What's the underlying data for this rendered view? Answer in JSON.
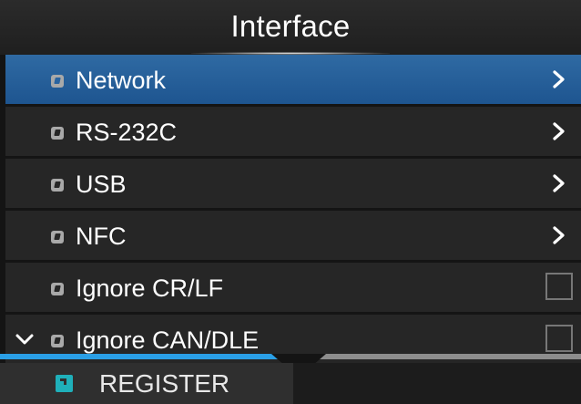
{
  "header": {
    "title": "Interface"
  },
  "menu": {
    "items": [
      {
        "label": "Network",
        "control": "chevron",
        "selected": true
      },
      {
        "label": "RS-232C",
        "control": "chevron",
        "selected": false
      },
      {
        "label": "USB",
        "control": "chevron",
        "selected": false
      },
      {
        "label": "NFC",
        "control": "chevron",
        "selected": false
      },
      {
        "label": "Ignore CR/LF",
        "control": "checkbox",
        "checked": false,
        "selected": false
      },
      {
        "label": "Ignore CAN/DLE",
        "control": "checkbox",
        "checked": false,
        "selected": false,
        "more_below": true
      }
    ]
  },
  "scroll": {
    "fraction": 0.48
  },
  "footer": {
    "register_label": "REGISTER",
    "register_icon": "register-icon"
  },
  "colors": {
    "selected_row": "#2a64a0",
    "progress": "#2a9fe6",
    "footer_icon": "#1fb0ba"
  }
}
